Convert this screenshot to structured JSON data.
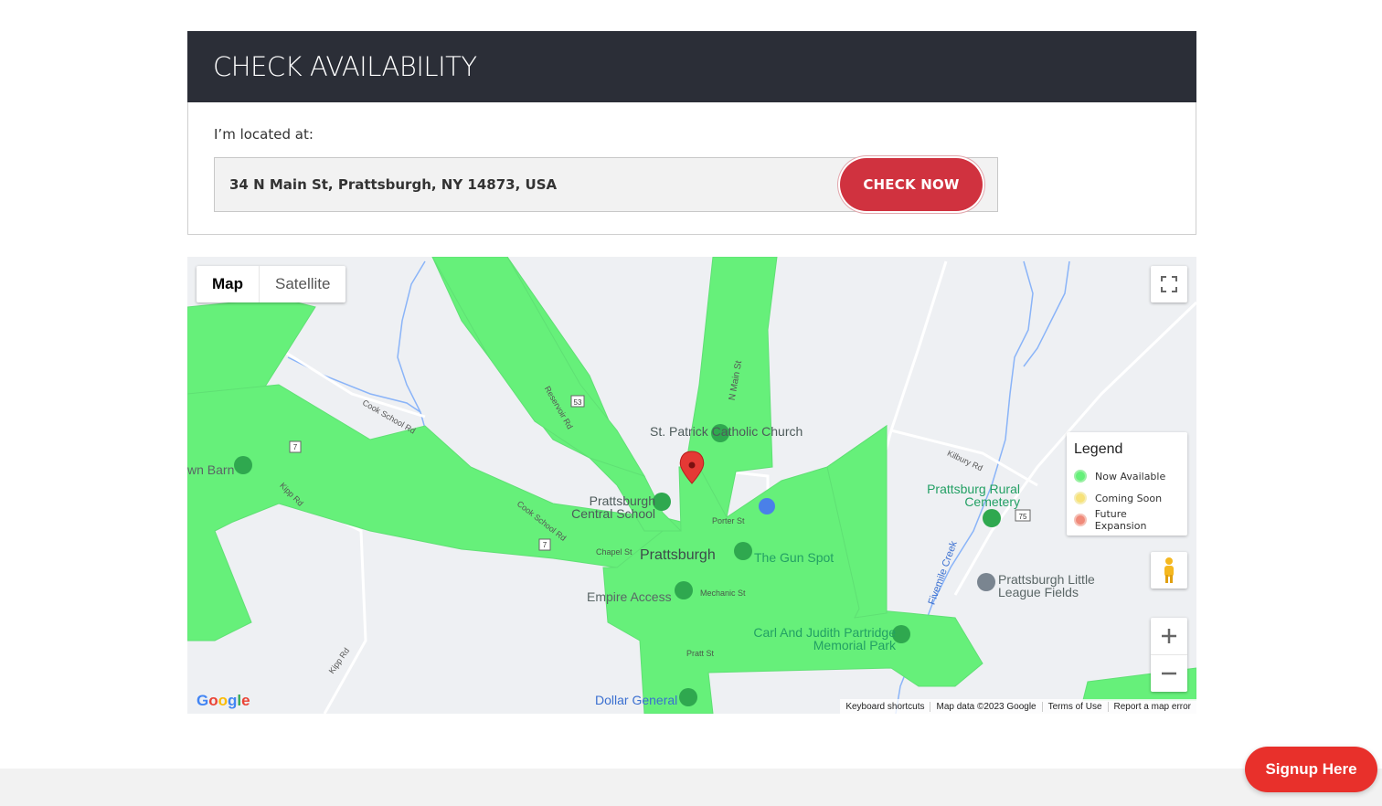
{
  "panel": {
    "title": "CHECK AVAILABILITY",
    "location_label": "I’m located at:",
    "address_value": "34 N Main St, Prattsburgh, NY 14873, USA",
    "check_button_label": "CHECK NOW"
  },
  "map": {
    "map_type_tabs": [
      "Map",
      "Satellite"
    ],
    "legend": {
      "title": "Legend",
      "items": [
        {
          "label": "Now Available",
          "color": "#66f07a"
        },
        {
          "label": "Coming Soon",
          "color": "#f7e27a"
        },
        {
          "label": "Future Expansion",
          "color": "#f08a7a"
        }
      ]
    },
    "places": {
      "st_patrick": "St. Patrick Catholic Church",
      "central_school": "Prattsburgh Central School",
      "town": "Prattsburgh",
      "gun_spot": "The Gun Spot",
      "empire_access": "Empire Access",
      "memorial_park": "Carl And Judith Partridge Memorial Park",
      "dollar_general": "Dollar General",
      "rural_cemetery": "Prattsburg Rural Cemetery",
      "little_league": "Prattsburgh Little League Fields",
      "town_barn": "wn Barn"
    },
    "roads": {
      "n_main": "N Main St",
      "reservoir": "Reservoir Rd",
      "cook_school": "Cook School Rd",
      "kipp": "Kipp Rd",
      "kilbury": "Kilbury Rd",
      "porter": "Porter St",
      "chapel": "Chapel St",
      "mechanic": "Mechanic St",
      "pratt": "Pratt St",
      "fivemile_creek": "Fivemile Creek",
      "route_53": "53",
      "route_75": "75",
      "route_7": "7"
    },
    "google_logo": "Google",
    "attribution": [
      "Keyboard shortcuts",
      "Map data ©2023 Google",
      "Terms of Use",
      "Report a map error"
    ]
  },
  "signup_button_label": "Signup Here",
  "colors": {
    "header_bg": "#2b2e37",
    "check_button": "#d0323f",
    "signup_button": "#e8302b",
    "coverage_green": "#66f07a"
  }
}
